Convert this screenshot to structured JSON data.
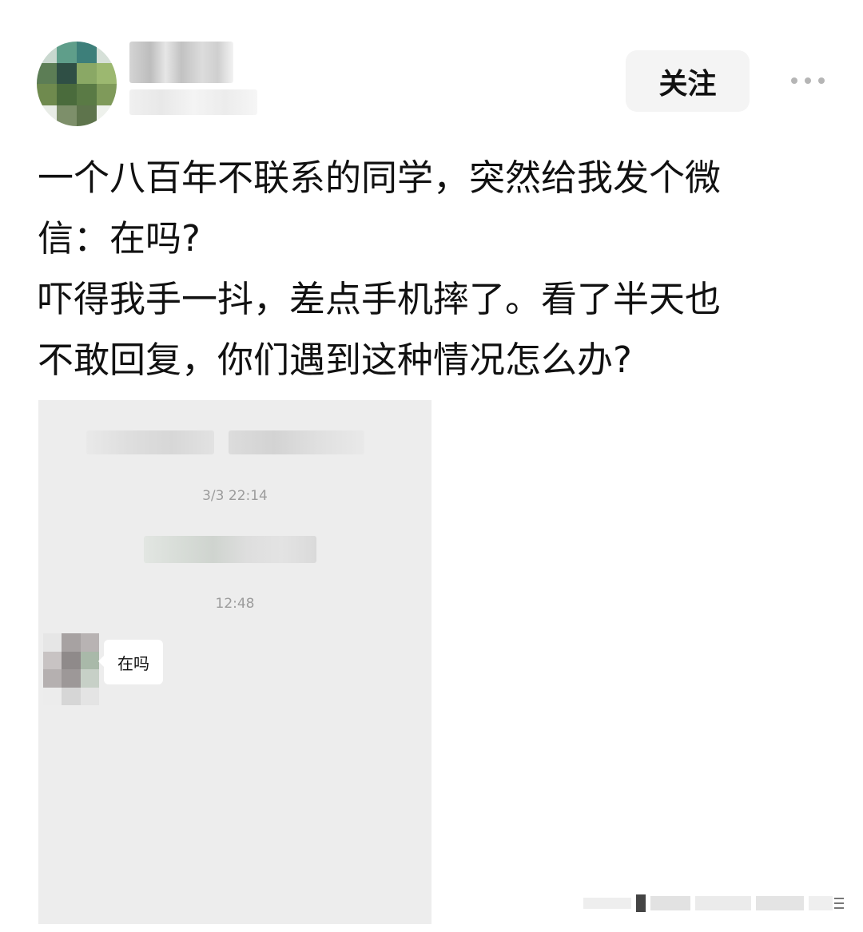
{
  "header": {
    "follow_label": "关注",
    "more_icon": "more-dots-icon"
  },
  "post": {
    "lines": [
      "一个八百年不联系的同学，突然给我发个微",
      "信：在吗?",
      "吓得我手一抖，差点手机摔了。看了半天也",
      "不敢回复，你们遇到这种情况怎么办?"
    ]
  },
  "chat_screenshot": {
    "timestamp_1": "3/3 22:14",
    "timestamp_2": "12:48",
    "message": "在吗"
  },
  "colors": {
    "follow_bg": "#f4f4f4",
    "chat_bg": "#ededed",
    "bubble_bg": "#ffffff",
    "timestamp": "#9c9c9c"
  }
}
